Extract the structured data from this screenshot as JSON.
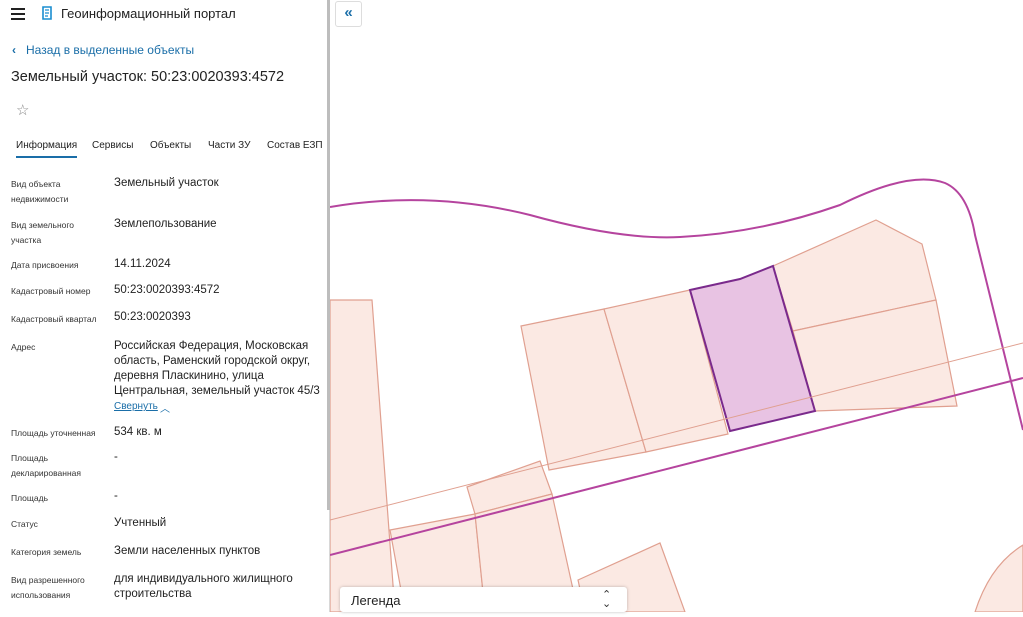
{
  "header": {
    "title": "Геоинформационный портал"
  },
  "back_link": "Назад в выделенные объекты",
  "page_title": "Земельный участок: 50:23:0020393:4572",
  "tabs": [
    "Информация",
    "Сервисы",
    "Объекты",
    "Части ЗУ",
    "Состав ЕЗП"
  ],
  "properties": [
    {
      "label": [
        "Вид объекта",
        "недвижимости"
      ],
      "value": [
        "Земельный участок"
      ]
    },
    {
      "label": [
        "Вид земельного",
        "участка"
      ],
      "value": [
        "Землепользование"
      ]
    },
    {
      "label": [
        "Дата присвоения"
      ],
      "value": [
        "14.11.2024"
      ]
    },
    {
      "label": [
        "Кадастровый номер"
      ],
      "value": [
        "50:23:0020393:4572"
      ]
    },
    {
      "label": [
        "Кадастровый квартал"
      ],
      "value": [
        "50:23:0020393"
      ]
    },
    {
      "label": [
        "Адрес"
      ],
      "value": [
        "Российская Федерация, Московская",
        "область, Раменский городской округ,",
        "деревня Пласкинино, улица",
        "Центральная, земельный участок 45/3"
      ]
    },
    {
      "label": [
        "Площадь уточненная"
      ],
      "value": [
        "534 кв. м"
      ]
    },
    {
      "label": [
        "Площадь",
        "декларированная"
      ],
      "value": [
        "-"
      ]
    },
    {
      "label": [
        "Площадь"
      ],
      "value": [
        "-"
      ]
    },
    {
      "label": [
        "Статус"
      ],
      "value": [
        "Учтенный"
      ]
    },
    {
      "label": [
        "Категория земель"
      ],
      "value": [
        "Земли населенных пунктов"
      ]
    },
    {
      "label": [
        "Вид разрешенного",
        "использования"
      ],
      "value": [
        "для индивидуального жилищного",
        "строительства"
      ]
    }
  ],
  "address_toggle": "Свернуть",
  "legend": {
    "label": "Легенда"
  },
  "icons": {
    "menu": "hamburger-icon",
    "logo": "portal-logo-icon",
    "back": "chevron-left-icon",
    "favorite": "star-icon",
    "collapse": "double-chevron-left-icon",
    "toggle": "chevron-up-icon",
    "legend_toggle": "chevron-updown-icon"
  },
  "colors": {
    "accent": "#1a6ea8",
    "parcel_fill": "#fbe9e3",
    "parcel_stroke": "#e0a090",
    "selected_fill": "#e8c3e3",
    "selected_stroke": "#7a2a8c",
    "boundary": "#b5449e"
  }
}
